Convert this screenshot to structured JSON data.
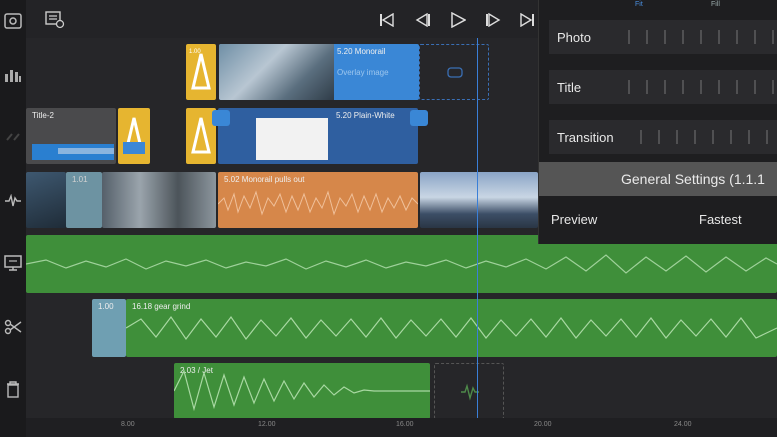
{
  "sidebar": {
    "icons": [
      "film-strip-icon",
      "bar-chart-icon",
      "link-icon",
      "waveform-edit-icon",
      "monitor-icon",
      "scissors-icon",
      "trash-icon"
    ]
  },
  "toolbar": {
    "icons": [
      "media-browser-icon",
      "skip-back-icon",
      "step-back-icon",
      "play-icon",
      "step-forward-icon",
      "skip-forward-icon"
    ]
  },
  "tracks": {
    "overlay1": {
      "clip_label": "5.20  Monorail",
      "clip_sublabel": "Overlay image"
    },
    "title": {
      "clip1_label": "Title-2",
      "clip2_label": "5.20  Plain-White"
    },
    "main": {
      "clip_label": "5.02  Monorail pulls out",
      "small_label": "1.01"
    },
    "audio2": {
      "clip_label": "1.00",
      "clip2_label": "16.18  gear grind"
    },
    "audio3": {
      "clip_label": "2.03 / Jet"
    }
  },
  "ruler": {
    "labels": [
      "8.00",
      "12.00",
      "16.00",
      "20.00",
      "24.00"
    ]
  },
  "panel": {
    "tabs": [
      "Fit",
      "Fill"
    ],
    "rows": [
      "Photo",
      "Title",
      "Transition"
    ],
    "general_settings": "General Settings (1.1.1",
    "preview_label": "Preview",
    "preview_value": "Fastest"
  },
  "colors": {
    "accent": "#3a7fd8",
    "audio_green": "#3f8f3a",
    "main_orange": "#d6874a",
    "title_blue": "#2f5fa0",
    "transition_yellow": "#e6b530"
  }
}
